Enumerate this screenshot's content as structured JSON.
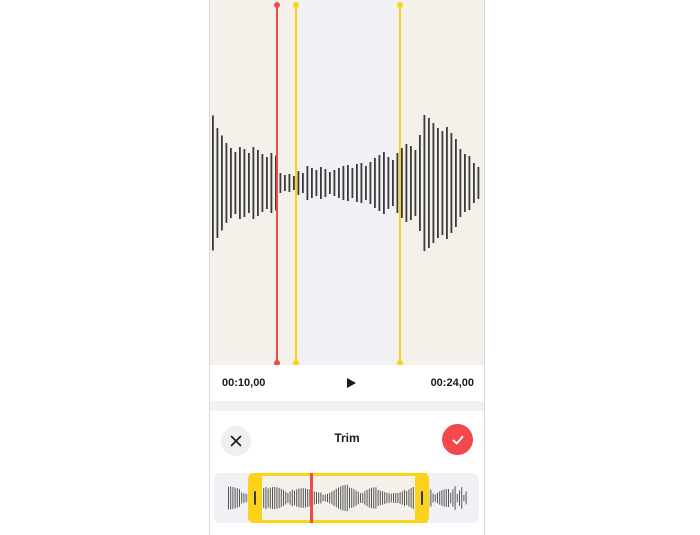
{
  "editor": {
    "start_time": "00:10,00",
    "end_time": "00:24,00",
    "title": "Trim"
  },
  "icons": {
    "play": "play-icon",
    "close": "close-icon",
    "confirm": "checkmark-icon",
    "grip": "grip-icon"
  },
  "colors": {
    "waveform_bg": "#f4f1ea",
    "selection_bg": "#eff1f4",
    "playhead": "#f2494d",
    "trim_handle": "#fcd21a",
    "bar": "#3a3a3a",
    "confirm": "#f2494d"
  }
}
